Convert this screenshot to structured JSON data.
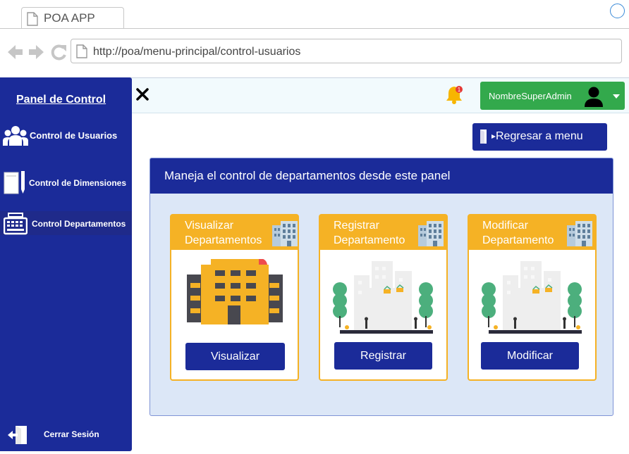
{
  "browser": {
    "tab_title": "POA APP",
    "url": "http://poa/menu-principal/control-usuarios"
  },
  "sidebar": {
    "title": "Panel de Control",
    "items": [
      {
        "label": "Control de Usuarios",
        "icon": "users-icon"
      },
      {
        "label": "Control de Dimensiones",
        "icon": "document-pen-icon"
      },
      {
        "label": "Control Departamentos",
        "icon": "register-icon"
      }
    ],
    "logout_label": "Cerrar Sesión"
  },
  "topbar": {
    "notification_count": "1",
    "user_name": "NombreSuperAdmin"
  },
  "back_button": {
    "label": "Regresar a menu"
  },
  "panel": {
    "title": "Maneja el control de departamentos desde este panel",
    "cards": [
      {
        "title_line1": "Visualizar",
        "title_line2": "Departamentos",
        "button": "Visualizar"
      },
      {
        "title_line1": "Registrar",
        "title_line2": "Departamento",
        "button": "Registrar"
      },
      {
        "title_line1": "Modificar",
        "title_line2": "Departamento",
        "button": "Modificar"
      }
    ]
  },
  "colors": {
    "primary": "#1b2b99",
    "accent": "#f5b225",
    "success": "#33a94c",
    "panel_bg": "#dce7f7"
  }
}
